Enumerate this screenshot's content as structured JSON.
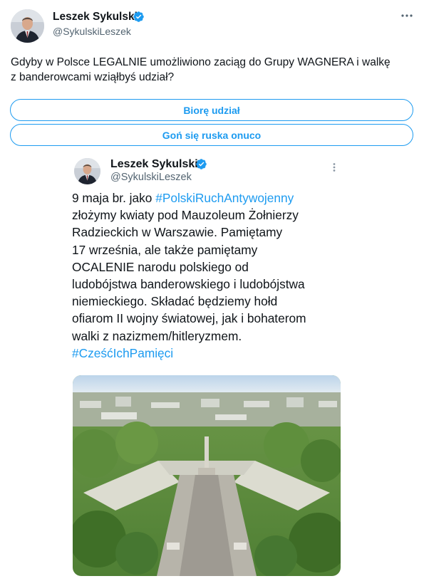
{
  "tweet": {
    "author_name": "Leszek Sykulski",
    "author_handle": "@SykulskiLeszek",
    "text_line1": "Gdyby w Polsce LEGALNIE umożliwiono zaciąg do Grupy WAGNERA i walkę",
    "text_line2": "z banderowcami wziąłbyś udział?",
    "poll_options": [
      "Biorę udział",
      "Goń się ruska onuco"
    ]
  },
  "embedded_tweet": {
    "author_name": "Leszek Sykulski",
    "author_handle": "@SykulskiLeszek",
    "line1_prefix": "9 maja br. jako ",
    "line1_hashtag": "#PolskiRuchAntywojenny",
    "line2": "złożymy kwiaty pod Mauzoleum Żołnierzy",
    "line3": "Radzieckich w Warszawie. Pamiętamy",
    "line4": "17 września, ale także pamiętamy",
    "line5": "OCALENIE narodu polskiego od",
    "line6": "ludobójstwa banderowskiego i ludobójstwa",
    "line7": "niemieckiego. Składać będziemy hołd",
    "line8": "ofiarom II wojny światowej, jak i bohaterom",
    "line9": "walki z nazizmem/hitleryzmem.",
    "line10_hashtag": "#CześćIchPamięci"
  },
  "icons": {
    "verified": "verified-badge-icon",
    "more": "more-options-icon"
  },
  "colors": {
    "accent": "#1d9bf0",
    "text": "#0f1419",
    "secondary": "#536471"
  }
}
